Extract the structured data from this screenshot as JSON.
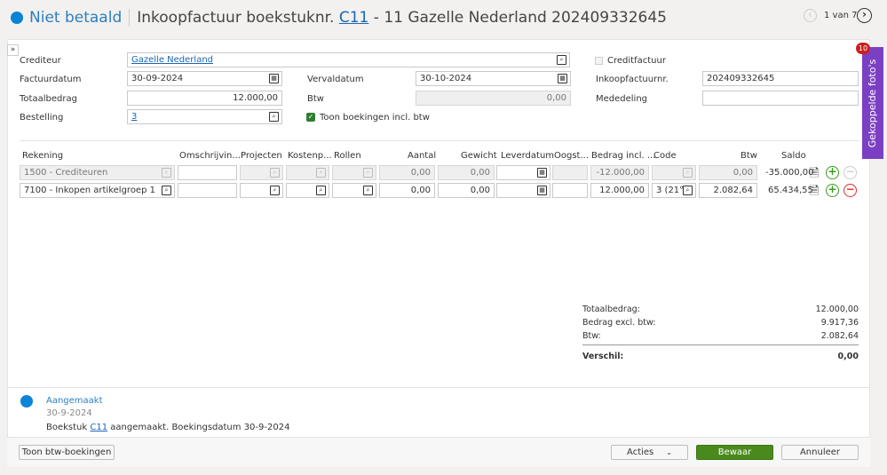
{
  "header": {
    "status": "Niet betaald",
    "title_prefix": "Inkoopfactuur boekstuknr.",
    "doc_link": "C11",
    "title_suffix": "- 11 Gazelle Nederland 202409332645",
    "pager": "1 van 7"
  },
  "side_tab": {
    "label": "Gekoppelde foto's",
    "badge": "10"
  },
  "form": {
    "crediteur_label": "Crediteur",
    "crediteur": "Gazelle Nederland",
    "factuurdatum_label": "Factuurdatum",
    "factuurdatum": "30-09-2024",
    "totaalbedrag_label": "Totaalbedrag",
    "totaalbedrag": "12.000,00",
    "bestelling_label": "Bestelling",
    "bestelling": "3",
    "vervaldatum_label": "Vervaldatum",
    "vervaldatum": "30-10-2024",
    "btw_label": "Btw",
    "btw": "0,00",
    "toon_label": "Toon boekingen incl. btw",
    "creditfactuur_label": "Creditfactuur",
    "inkoopfactuurnr_label": "Inkoopfactuurnr.",
    "inkoopfactuurnr": "202409332645",
    "mededeling_label": "Mededeling",
    "mededeling": ""
  },
  "table": {
    "headers": [
      "Rekening",
      "Omschrijvin...",
      "Projecten",
      "Kostenp...",
      "Rollen",
      "Aantal",
      "Gewicht",
      "Leverdatum",
      "Oogst...",
      "Bedrag incl. ...",
      "Code",
      "Btw",
      "Saldo"
    ],
    "rows": [
      {
        "rekening": "1500 - Crediteuren",
        "aantal": "0,00",
        "gewicht": "0,00",
        "bedrag": "-12.000,00",
        "code": "",
        "btw": "0,00",
        "saldo": "-35.000,00"
      },
      {
        "rekening": "7100 - Inkopen artikelgroep 1",
        "aantal": "0,00",
        "gewicht": "0,00",
        "bedrag": "12.000,00",
        "code": "3 (21°",
        "btw": "2.082,64",
        "saldo": "65.434,55"
      }
    ]
  },
  "totals": {
    "totaal_label": "Totaalbedrag:",
    "totaal": "12.000,00",
    "excl_label": "Bedrag excl. btw:",
    "excl": "9.917,36",
    "btw_label": "Btw:",
    "btw": "2.082,64",
    "verschil_label": "Verschil:",
    "verschil": "0,00"
  },
  "history": {
    "event": "Aangemaakt",
    "date": "30-9-2024",
    "text_prefix": "Boekstuk",
    "link": "C11",
    "text_suffix": "aangemaakt. Boekingsdatum 30-9-2024"
  },
  "footer": {
    "toon_btw": "Toon btw-boekingen",
    "acties": "Acties",
    "bewaar": "Bewaar",
    "annuleer": "Annuleer"
  },
  "colors": {
    "accent": "#0a84d6",
    "save": "#4a8a1c",
    "tab": "#7b3fc4"
  }
}
